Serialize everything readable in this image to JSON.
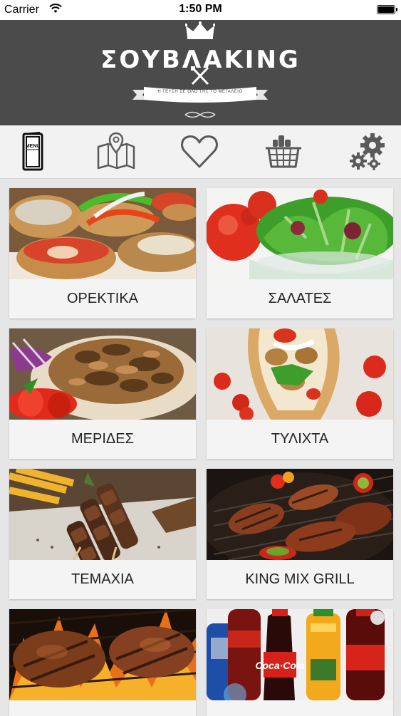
{
  "status_bar": {
    "carrier": "Carrier",
    "time": "1:50 PM"
  },
  "header": {
    "logo": "ΣΟΥΒΛΑΚΙΝG",
    "tagline": "Η ΓΕΥΣΗ ΣΕ ΟΛΟ ΤΗΣ ΤΟ ΜΕΓΑΛΕΙΟ"
  },
  "toolbar": {
    "items": [
      {
        "name": "menu",
        "icon": "menu-book-icon",
        "label": "MENU"
      },
      {
        "name": "map",
        "icon": "map-pin-icon"
      },
      {
        "name": "favorites",
        "icon": "heart-icon"
      },
      {
        "name": "cart",
        "icon": "shopping-basket-icon"
      },
      {
        "name": "settings",
        "icon": "gears-icon"
      }
    ]
  },
  "categories": [
    {
      "label": "ΟΡΕΚΤΙΚΑ",
      "image": "bruschetta"
    },
    {
      "label": "ΣΑΛΑΤΕΣ",
      "image": "salad"
    },
    {
      "label": "ΜΕΡΙΔΕΣ",
      "image": "gyros-plate"
    },
    {
      "label": "ΤΥΛΙΧΤΑ",
      "image": "pita-wrap"
    },
    {
      "label": "ΤΕΜΑΧΙΑ",
      "image": "souvlaki-skewers"
    },
    {
      "label": "KING MIX GRILL",
      "image": "mixed-grill"
    },
    {
      "label": "",
      "image": "steaks-on-fire"
    },
    {
      "label": "",
      "image": "soft-drinks"
    }
  ],
  "colors": {
    "header_bg": "#4b4b4b",
    "toolbar_bg": "#f2f2f2",
    "grid_bg": "#e6e6e6",
    "icon_gray": "#5a5a5a"
  }
}
